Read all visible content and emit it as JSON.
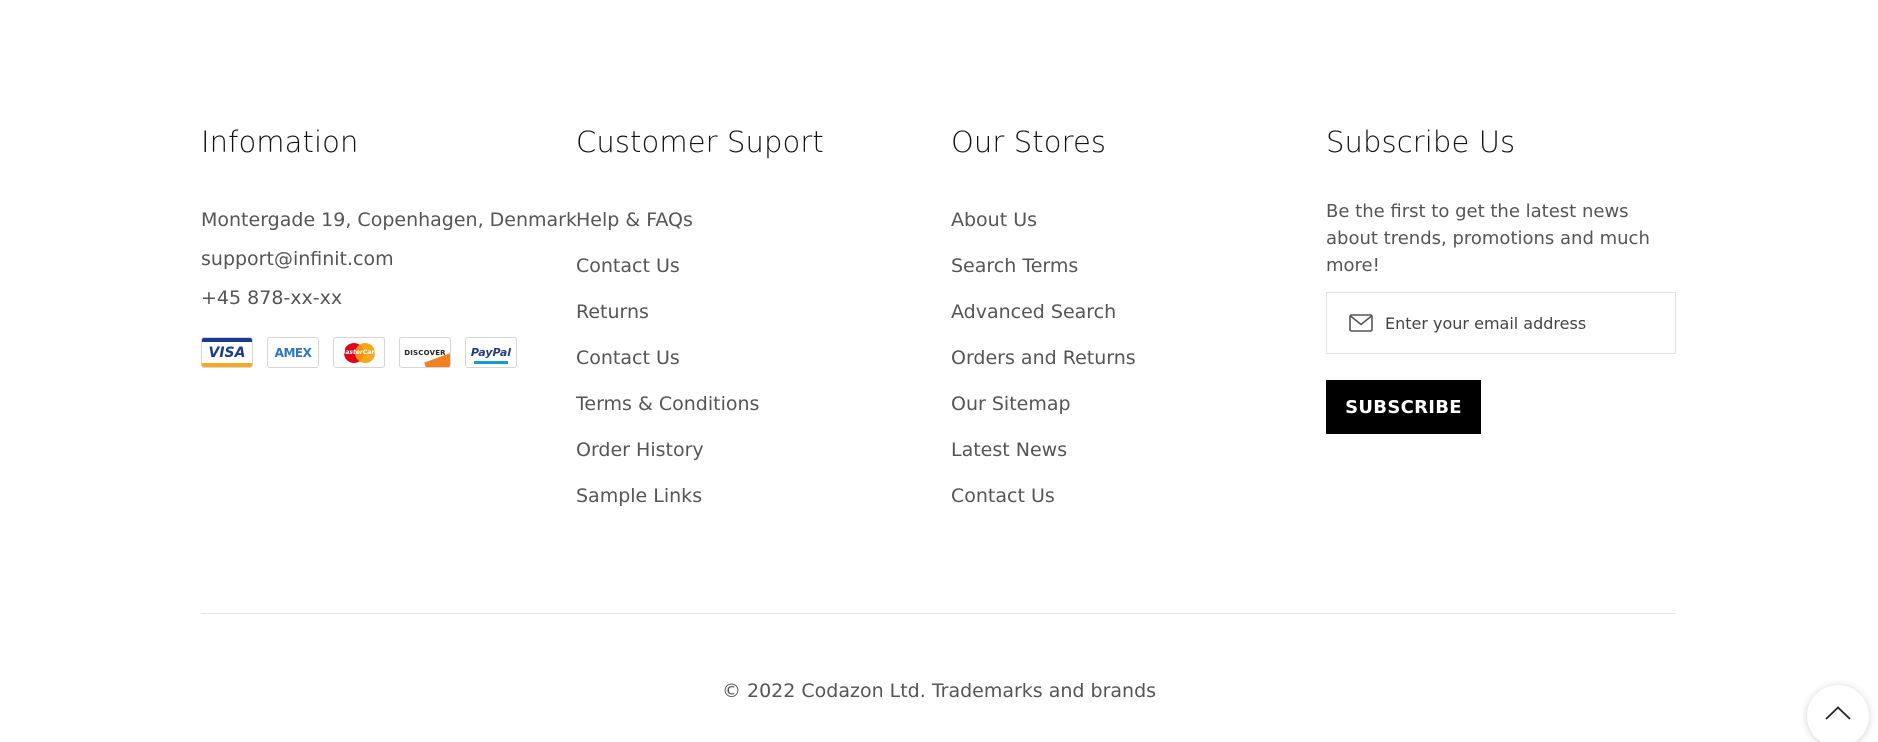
{
  "info": {
    "title": "Infomation",
    "address": "Montergade 19, Copenhagen, Denmark",
    "email": "support@infinit.com",
    "phone": "+45 878-xx-xx",
    "payments": [
      {
        "name": "visa",
        "label": "VISA",
        "icon": "visa-card-icon"
      },
      {
        "name": "amex",
        "label": "AMEX",
        "icon": "amex-card-icon"
      },
      {
        "name": "mastercard",
        "label": "MasterCard",
        "icon": "mastercard-card-icon"
      },
      {
        "name": "discover",
        "label": "DISCOVER",
        "icon": "discover-card-icon"
      },
      {
        "name": "paypal",
        "label": "PayPal",
        "icon": "paypal-card-icon"
      }
    ]
  },
  "support": {
    "title": "Customer Suport",
    "links": [
      "Help & FAQs",
      "Contact Us",
      "Returns",
      "Contact Us",
      "Terms & Conditions",
      "Order History",
      "Sample Links"
    ]
  },
  "stores": {
    "title": "Our Stores",
    "links": [
      "About Us",
      "Search Terms",
      "Advanced Search",
      "Orders and Returns",
      "Our Sitemap",
      "Latest News",
      "Contact Us"
    ]
  },
  "subscribe": {
    "title": "Subscribe Us",
    "description": "Be the first to get the latest news about trends, promotions and much more!",
    "email_placeholder": "Enter your email address",
    "email_value": "",
    "button_label": "SUBSCRIBE",
    "mail_icon": "mail-icon"
  },
  "copyright": "© 2022 Codazon Ltd. Trademarks and brands",
  "back_to_top_icon": "chevron-up-icon",
  "colors": {
    "text": "#555555",
    "heading": "#111111",
    "button_bg": "#000000",
    "button_text": "#ffffff",
    "divider": "#e6e6e6"
  }
}
